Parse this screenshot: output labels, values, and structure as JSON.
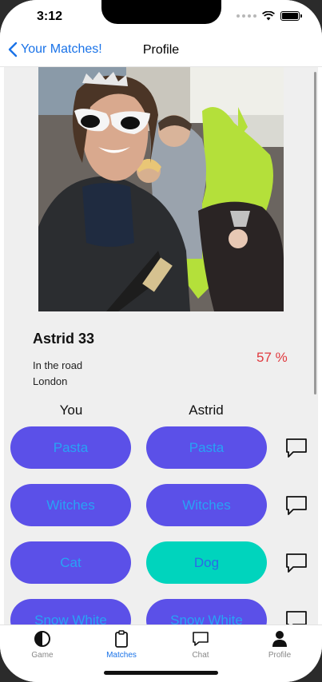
{
  "status": {
    "time": "3:12"
  },
  "nav": {
    "back_label": "Your Matches!",
    "title": "Profile"
  },
  "profile": {
    "name": "Astrid 33",
    "address_line1": "In the road",
    "address_line2": "London",
    "match_percent": "57 %"
  },
  "columns": {
    "you": "You",
    "them": "Astrid"
  },
  "rows": [
    {
      "you": "Pasta",
      "them": "Pasta"
    },
    {
      "you": "Witches",
      "them": "Witches"
    },
    {
      "you": "Cat",
      "them": "Dog"
    },
    {
      "you": "Snow White",
      "them": "Snow White"
    }
  ],
  "tabs": [
    {
      "label": "Game",
      "icon": "contrast-icon"
    },
    {
      "label": "Matches",
      "icon": "clipboard-icon"
    },
    {
      "label": "Chat",
      "icon": "chat-bubble-icon"
    },
    {
      "label": "Profile",
      "icon": "person-icon"
    }
  ],
  "colors": {
    "accent": "#1a73e8",
    "pill": "#5b50e8",
    "pill_text": "#28a3f5",
    "pill_match": "#00d4bd",
    "percent": "#e0393e"
  }
}
